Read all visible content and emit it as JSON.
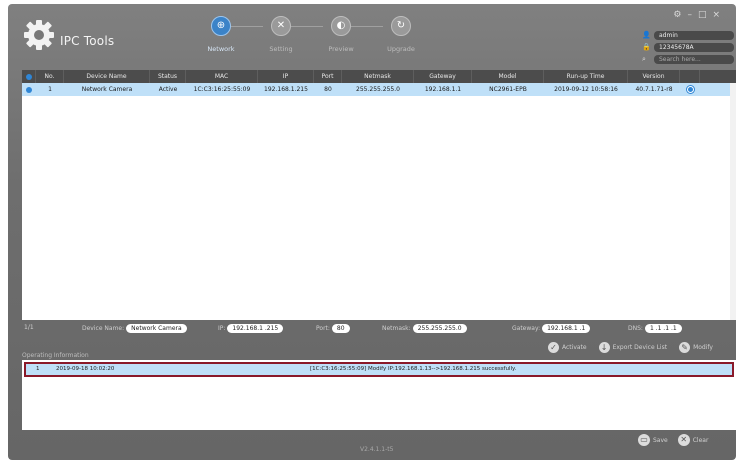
{
  "app": {
    "title": "IPC Tools",
    "version": "V2.4.1.1-t5"
  },
  "window": {
    "controls": [
      "⚙",
      "–",
      "□",
      "×"
    ]
  },
  "steps": [
    {
      "label": "Network",
      "icon": "globe-icon",
      "glyph": "⊕",
      "active": true
    },
    {
      "label": "Setting",
      "icon": "wrench-icon",
      "glyph": "✕",
      "active": false
    },
    {
      "label": "Preview",
      "icon": "preview-icon",
      "glyph": "◐",
      "active": false
    },
    {
      "label": "Upgrade",
      "icon": "upgrade-icon",
      "glyph": "↻",
      "active": false
    }
  ],
  "login": {
    "username": "admin",
    "password": "12345678A",
    "search_placeholder": "Search here..."
  },
  "table": {
    "headers": [
      "",
      "No.",
      "Device Name",
      "Status",
      "MAC",
      "IP",
      "Port",
      "Netmask",
      "Gateway",
      "Model",
      "Run-up Time",
      "Version",
      ""
    ],
    "rows": [
      [
        "",
        "1",
        "Network Camera",
        "Active",
        "1C:C3:16:25:55:09",
        "192.168.1.215",
        "80",
        "255.255.255.0",
        "192.168.1.1",
        "NC2961-EPB",
        "2019-09-12 10:58:16",
        "40.7.1.71-r8",
        ""
      ]
    ]
  },
  "editbar": {
    "page": "1/1",
    "device_name_label": "Device Name:",
    "device_name": "Network Camera",
    "ip_label": "IP:",
    "ip": "192.168.1 .215",
    "port_label": "Port:",
    "port": "80",
    "netmask_label": "Netmask:",
    "netmask": "255.255.255.0",
    "gateway_label": "Gateway:",
    "gateway": "192.168.1 .1",
    "dns_label": "DNS:",
    "dns": "1 .1 .1 .1"
  },
  "actions": {
    "activate": "Activate",
    "export": "Export Device List",
    "modify": "Modify"
  },
  "operating": {
    "label": "Operating Information",
    "rows": [
      {
        "no": "1",
        "time": "2019-09-18 10:02:20",
        "message": "[1C:C3:16:25:55:09] Modify  IP:192.168.1.13-->192.168.1.215 successfully."
      }
    ]
  },
  "footer": {
    "save": "Save",
    "clear": "Clear"
  },
  "colors": {
    "accent": "#2f86d6",
    "selected_row": "#bfe0f8",
    "highlight_border": "#8a1a2a"
  }
}
